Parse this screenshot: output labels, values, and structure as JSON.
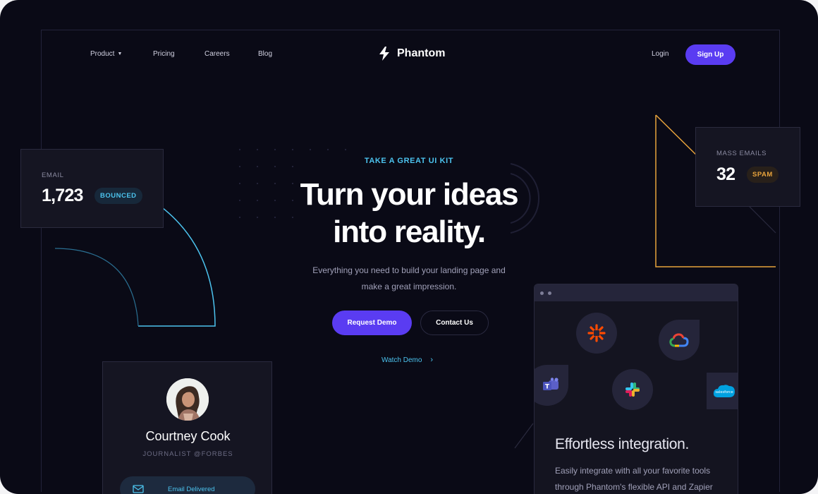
{
  "nav": {
    "product": "Product",
    "pricing": "Pricing",
    "careers": "Careers",
    "blog": "Blog",
    "brand": "Phantom",
    "login": "Login",
    "signup": "Sign Up"
  },
  "hero": {
    "kicker": "TAKE A GREAT UI KIT",
    "title_line1": "Turn your ideas",
    "title_line2": "into reality.",
    "sub_line1": "Everything you need to build your landing page and",
    "sub_line2": "make a great impression.",
    "request_demo": "Request Demo",
    "contact_us": "Contact Us",
    "watch_demo": "Watch Demo"
  },
  "email_card": {
    "label": "EMAIL",
    "value": "1,723",
    "badge": "BOUNCED"
  },
  "mass_card": {
    "label": "MASS EMAILS",
    "value": "32",
    "badge": "SPAM"
  },
  "profile_card": {
    "name": "Courtney Cook",
    "role": "JOURNALIST @FORBES",
    "status": "Email Delivered"
  },
  "integration_card": {
    "title": "Effortless integration.",
    "desc_line1": "Easily integrate with all your favorite tools",
    "desc_line2": "through Phantom's flexible API and Zapier",
    "logos": [
      "zapier-icon",
      "google-cloud-icon",
      "teams-icon",
      "slack-icon",
      "salesforce-icon"
    ],
    "salesforce_text": "salesforce"
  },
  "colors": {
    "background": "#0a0a16",
    "accent_purple": "#5a3cf2",
    "accent_cyan": "#4cc3ee",
    "accent_orange": "#e8a33c",
    "card_bg": "#151522"
  }
}
